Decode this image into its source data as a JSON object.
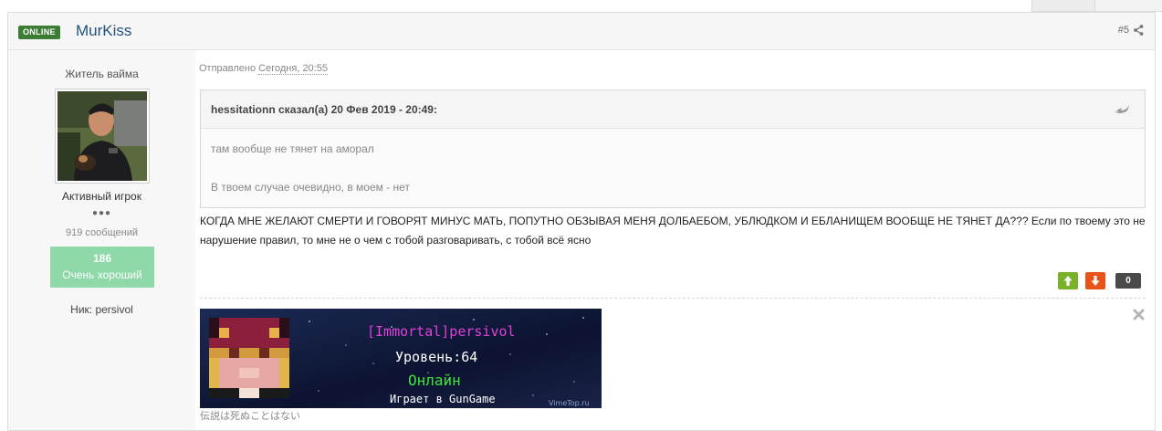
{
  "post": {
    "status_badge": "ONLINE",
    "author": "MurKiss",
    "number": "#5",
    "icons": {
      "share": "share-icon",
      "quote": "quote-icon",
      "close": "close-icon",
      "vote_up": "arrow-up-icon",
      "vote_down": "arrow-down-icon"
    },
    "colors": {
      "online_badge": "#3c7d34",
      "reputation": "#8fd9a8",
      "vote_up": "#79b22a",
      "vote_down": "#e8531a",
      "author_link": "#23527a"
    }
  },
  "author_info": {
    "rank_title": "Житель вайма",
    "group": "Активный игрок",
    "pips": "●●●",
    "messages": "919 сообщений",
    "reputation_value": "186",
    "reputation_label": "Очень хороший",
    "nick": "Ник: persivol"
  },
  "meta": {
    "posted_prefix": "Отправлено",
    "posted_time": "Сегодня, 20:55"
  },
  "quote": {
    "author_line": "hessitationn сказал(а) 20 Фев 2019 - 20:49:",
    "lines": [
      "там вообще не тянет на аморал",
      "В твоем случае очевидно, в моем - нет"
    ]
  },
  "body": {
    "text": "КОГДА МНЕ ЖЕЛАЮТ СМЕРТИ И ГОВОРЯТ МИНУС МАТЬ, ПОПУТНО ОБЗЫВАЯ МЕНЯ ДОЛБАЕБОМ, УБЛЮДКОМ И ЕБЛАНИЩЕМ ВООБЩЕ НЕ ТЯНЕТ ДА??? Если по твоему это не нарушение правил, то мне не о чем с тобой разговаривать, с тобой всё ясно"
  },
  "votes": {
    "count": "0"
  },
  "signature": {
    "banner_name": "[Immortal]persivol",
    "banner_level": "Уровень:64",
    "banner_status": "Онлайн",
    "banner_game": "Играет в GunGame",
    "banner_site": "VimeTop.ru",
    "caption": "伝説は死ぬことはない"
  }
}
